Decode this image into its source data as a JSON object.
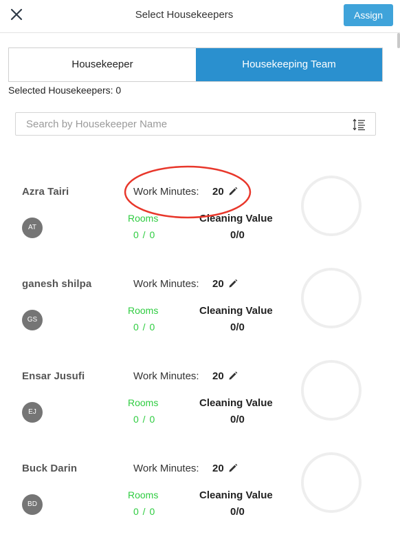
{
  "header": {
    "title": "Select Housekeepers",
    "assign_label": "Assign",
    "close_icon": "close-icon"
  },
  "tabs": [
    {
      "label": "Housekeeper",
      "active": false
    },
    {
      "label": "Housekeeping Team",
      "active": true
    }
  ],
  "selected_text": "Selected Housekeepers: 0",
  "search": {
    "placeholder": "Search by Housekeeper Name",
    "value": "",
    "sort_icon": "sort-icon"
  },
  "labels": {
    "work_minutes": "Work Minutes:",
    "rooms": "Rooms",
    "cleaning_value": "Cleaning Value"
  },
  "housekeepers": [
    {
      "name": "Azra Tairi",
      "initials": "AT",
      "work_minutes": "20",
      "rooms": "0 / 0",
      "cleaning_value": "0/0"
    },
    {
      "name": "ganesh shilpa",
      "initials": "GS",
      "work_minutes": "20",
      "rooms": "0 / 0",
      "cleaning_value": "0/0"
    },
    {
      "name": "Ensar Jusufi",
      "initials": "EJ",
      "work_minutes": "20",
      "rooms": "0 / 0",
      "cleaning_value": "0/0"
    },
    {
      "name": "Buck Darin",
      "initials": "BD",
      "work_minutes": "20",
      "rooms": "0 / 0",
      "cleaning_value": "0/0"
    }
  ],
  "colors": {
    "assign_button": "#3fa3da",
    "active_tab": "#2a90cf",
    "rooms_text": "#2ecc40",
    "avatar": "#757575",
    "progress_ring": "#eeeeee",
    "annotation_ellipse": "#e8372b"
  }
}
